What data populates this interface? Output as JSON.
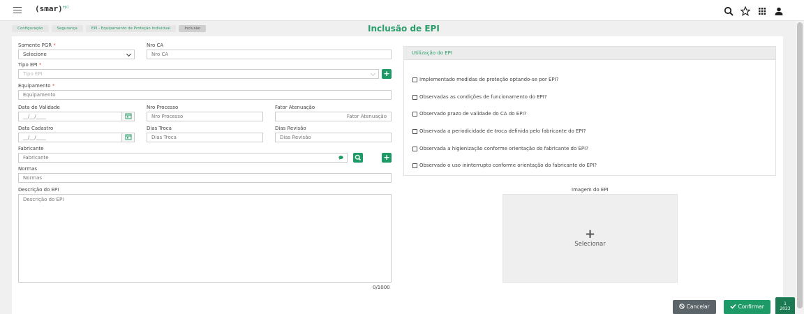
{
  "header": {
    "logo_text": "(smar)",
    "logo_sup": "epi"
  },
  "breadcrumb": [
    "Configuração",
    "Segurança",
    "EPI - Equipamento de Proteção Individual",
    "Inclusão"
  ],
  "page_title": "Inclusão de EPI",
  "form": {
    "somente_pgr": {
      "label": "Somente PGR",
      "required": "*",
      "value": "Selecione"
    },
    "nro_ca": {
      "label": "Nro CA",
      "placeholder": "Nro CA"
    },
    "tipo_epi": {
      "label": "Tipo EPI",
      "required": "*",
      "placeholder": "Tipo EPI"
    },
    "equipamento": {
      "label": "Equipamento",
      "required": "*",
      "placeholder": "Equipamento"
    },
    "data_validade": {
      "label": "Data de Validade",
      "placeholder": "__/__/____"
    },
    "nro_processo": {
      "label": "Nro Processo",
      "placeholder": "Nro Processo"
    },
    "fator_atenuacao": {
      "label": "Fator Atenuação",
      "placeholder": "Fator Atenuação"
    },
    "data_cadastro": {
      "label": "Data Cadastro",
      "placeholder": "__/__/____"
    },
    "dias_troca": {
      "label": "Dias Troca",
      "placeholder": "Dias Troca"
    },
    "dias_revisao": {
      "label": "Dias Revisão",
      "placeholder": "Dias Revisão"
    },
    "fabricante": {
      "label": "Fabricante",
      "placeholder": "Fabricante"
    },
    "normas": {
      "label": "Normas",
      "placeholder": "Normas"
    },
    "descricao": {
      "label": "Descrição do EPI",
      "placeholder": "Descrição do EPI",
      "counter": "0/1000"
    }
  },
  "utilizacao": {
    "title": "Utilização do EPI",
    "items": [
      "Implementado medidas de proteção optando-se por EPI?",
      "Observadas as condições de funcionamento do EPI?",
      "Observado prazo de validade do CA do EPI?",
      "Observada a periodicidade de troca definida pelo fabricante do EPI?",
      "Observada a higienização conforme orientação do fabricante do EPI?",
      "Observado o uso ininterrupto conforme orientação do fabricante do EPI?"
    ]
  },
  "imagem": {
    "label": "Imagem do EPI",
    "plus": "+",
    "select_label": "Selecionar"
  },
  "actions": {
    "cancel": "Cancelar",
    "confirm": "Confirmar"
  },
  "version_badge": {
    "line1": "1",
    "line2": "2023"
  },
  "colors": {
    "accent": "#2a9d6a",
    "button_green": "#1e9a66",
    "cancel_gray": "#5b6468",
    "required_red": "#d9534f"
  }
}
